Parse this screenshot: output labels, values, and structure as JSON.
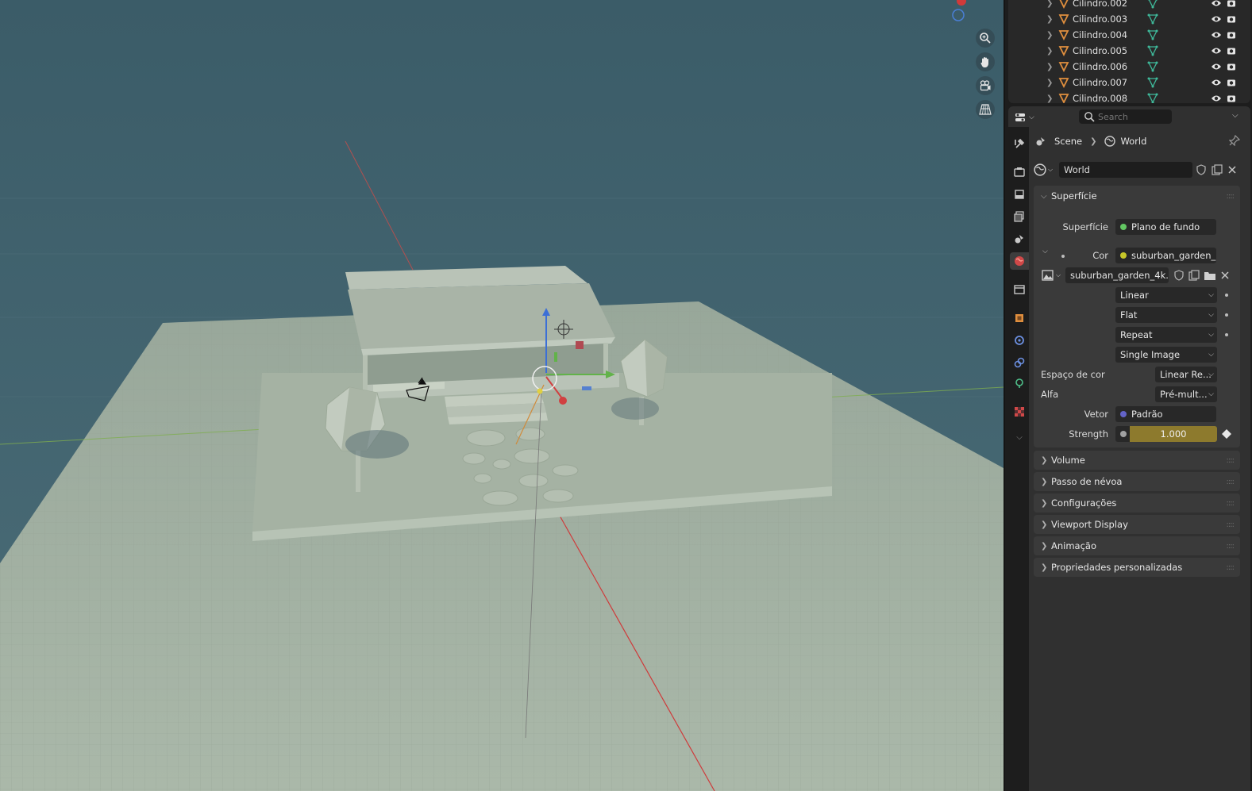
{
  "outliner": {
    "rows": [
      {
        "name": "Cilindro.002"
      },
      {
        "name": "Cilindro.003"
      },
      {
        "name": "Cilindro.004"
      },
      {
        "name": "Cilindro.005"
      },
      {
        "name": "Cilindro.006"
      },
      {
        "name": "Cilindro.007"
      },
      {
        "name": "Cilindro.008"
      }
    ]
  },
  "properties": {
    "search_placeholder": "Search",
    "breadcrumb": {
      "scene": "Scene",
      "world": "World"
    },
    "world_name": "World",
    "panels": {
      "superficie": {
        "title": "Superfície",
        "surface_label": "Superfície",
        "surface_value": "Plano de fundo",
        "cor_label": "Cor",
        "cor_value": "suburban_garden_...",
        "image_name": "suburban_garden_4k...",
        "interpolation": "Linear",
        "projection": "Flat",
        "extension": "Repeat",
        "source": "Single Image",
        "colorspace_label": "Espaço de cor",
        "colorspace_value": "Linear Re...",
        "alpha_label": "Alfa",
        "alpha_value": "Pré-mult...",
        "vector_label": "Vetor",
        "vector_value": "Padrão",
        "strength_label": "Strength",
        "strength_value": "1.000"
      },
      "collapsed": [
        {
          "title": "Volume"
        },
        {
          "title": "Passo de névoa"
        },
        {
          "title": "Configurações"
        },
        {
          "title": "Viewport Display"
        },
        {
          "title": "Animação"
        },
        {
          "title": "Propriedades personalizadas"
        }
      ]
    }
  },
  "colors": {
    "viewport_bg": "#3e5f6b",
    "floor": "#a7b3a4",
    "panel_bg": "#303030",
    "strength_bar": "#8d7a2d",
    "surface_socket": "#63c763",
    "color_socket": "#c7c729",
    "vector_socket": "#6363c7"
  },
  "icons": [
    "zoom-icon",
    "hand-icon",
    "camera-icon",
    "grid-icon",
    "search-icon",
    "pin-icon",
    "world-icon",
    "scene-icon",
    "mesh-icon",
    "eye-icon",
    "camera-render-icon"
  ]
}
